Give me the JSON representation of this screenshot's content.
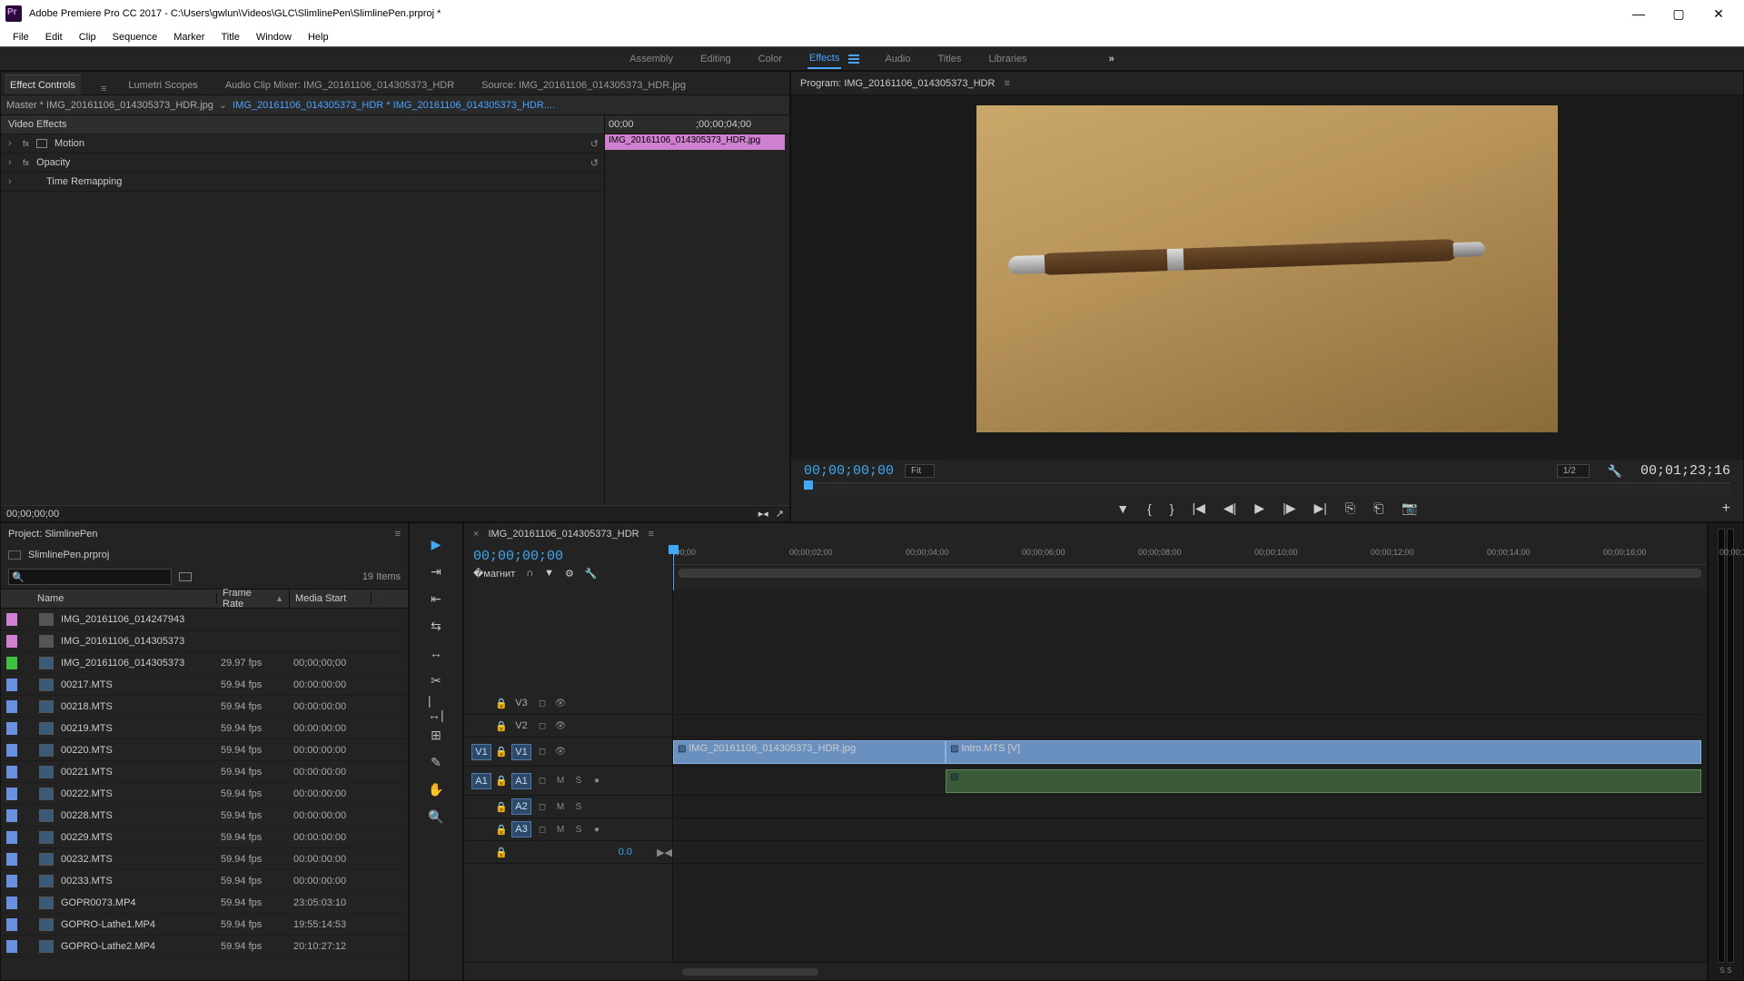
{
  "title": "Adobe Premiere Pro CC 2017 - C:\\Users\\gwlun\\Videos\\GLC\\SlimlinePen\\SlimlinePen.prproj *",
  "menu": [
    "File",
    "Edit",
    "Clip",
    "Sequence",
    "Marker",
    "Title",
    "Window",
    "Help"
  ],
  "workspaces": [
    "Assembly",
    "Editing",
    "Color",
    "Effects",
    "Audio",
    "Titles",
    "Libraries"
  ],
  "ws_active": "Effects",
  "ec": {
    "tabs": [
      "Effect Controls",
      "Lumetri Scopes",
      "Audio Clip Mixer: IMG_20161106_014305373_HDR",
      "Source: IMG_20161106_014305373_HDR.jpg"
    ],
    "master": "Master * IMG_20161106_014305373_HDR.jpg",
    "clipname": "IMG_20161106_014305373_HDR * IMG_20161106_014305373_HDR....",
    "section": "Video Effects",
    "rows": [
      "Motion",
      "Opacity",
      "Time Remapping"
    ],
    "ruler": [
      "00;00",
      ";00;00;04;00"
    ],
    "clip_bar": "IMG_20161106_014305373_HDR.jpg",
    "foot_tc": "00;00;00;00"
  },
  "program": {
    "title": "Program: IMG_20161106_014305373_HDR",
    "tc": "00;00;00;00",
    "fit": "Fit",
    "res": "1/2",
    "dur": "00;01;23;16"
  },
  "project": {
    "title": "Project: SlimlinePen",
    "file": "SlimlinePen.prproj",
    "count": "19 Items",
    "cols": [
      "Name",
      "Frame Rate",
      "Media Start"
    ],
    "rows": [
      {
        "c": "#d080d0",
        "t": "img",
        "n": "IMG_20161106_014247943",
        "f": "",
        "m": ""
      },
      {
        "c": "#d080d0",
        "t": "img",
        "n": "IMG_20161106_014305373",
        "f": "",
        "m": ""
      },
      {
        "c": "#40c040",
        "t": "vid",
        "n": "IMG_20161106_014305373",
        "f": "29.97 fps",
        "m": "00;00;00;00"
      },
      {
        "c": "#6a90e0",
        "t": "vid",
        "n": "00217.MTS",
        "f": "59.94 fps",
        "m": "00:00:00:00"
      },
      {
        "c": "#6a90e0",
        "t": "vid",
        "n": "00218.MTS",
        "f": "59.94 fps",
        "m": "00:00:00:00"
      },
      {
        "c": "#6a90e0",
        "t": "vid",
        "n": "00219.MTS",
        "f": "59.94 fps",
        "m": "00:00:00:00"
      },
      {
        "c": "#6a90e0",
        "t": "vid",
        "n": "00220.MTS",
        "f": "59.94 fps",
        "m": "00:00:00:00"
      },
      {
        "c": "#6a90e0",
        "t": "vid",
        "n": "00221.MTS",
        "f": "59.94 fps",
        "m": "00:00:00:00"
      },
      {
        "c": "#6a90e0",
        "t": "vid",
        "n": "00222.MTS",
        "f": "59.94 fps",
        "m": "00:00:00:00"
      },
      {
        "c": "#6a90e0",
        "t": "vid",
        "n": "00228.MTS",
        "f": "59.94 fps",
        "m": "00:00:00:00"
      },
      {
        "c": "#6a90e0",
        "t": "vid",
        "n": "00229.MTS",
        "f": "59.94 fps",
        "m": "00:00:00:00"
      },
      {
        "c": "#6a90e0",
        "t": "vid",
        "n": "00232.MTS",
        "f": "59.94 fps",
        "m": "00:00:00:00"
      },
      {
        "c": "#6a90e0",
        "t": "vid",
        "n": "00233.MTS",
        "f": "59.94 fps",
        "m": "00:00:00:00"
      },
      {
        "c": "#6a90e0",
        "t": "vid",
        "n": "GOPR0073.MP4",
        "f": "59.94 fps",
        "m": "23:05:03:10"
      },
      {
        "c": "#6a90e0",
        "t": "vid",
        "n": "GOPRO-Lathe1.MP4",
        "f": "59.94 fps",
        "m": "19:55:14:53"
      },
      {
        "c": "#6a90e0",
        "t": "vid",
        "n": "GOPRO-Lathe2.MP4",
        "f": "59.94 fps",
        "m": "20:10:27:12"
      }
    ]
  },
  "timeline": {
    "seq": "IMG_20161106_014305373_HDR",
    "tc": "00;00;00;00",
    "marks": [
      ";00;00",
      "00;00;02;00",
      "00;00;04;00",
      "00;00;06;00",
      "00;00;08;00",
      "00;00;10;00",
      "00;00;12;00",
      "00;00;14;00",
      "00;00;16;00",
      "00;00;1"
    ],
    "v": [
      "V3",
      "V2",
      "V1"
    ],
    "a": [
      "A1",
      "A2",
      "A3"
    ],
    "src_v": "V1",
    "src_a": "A1",
    "clip1": "IMG_20161106_014305373_HDR.jpg",
    "clip2": "Intro.MTS [V]",
    "zoom": "0.0",
    "meter": "S  S"
  }
}
